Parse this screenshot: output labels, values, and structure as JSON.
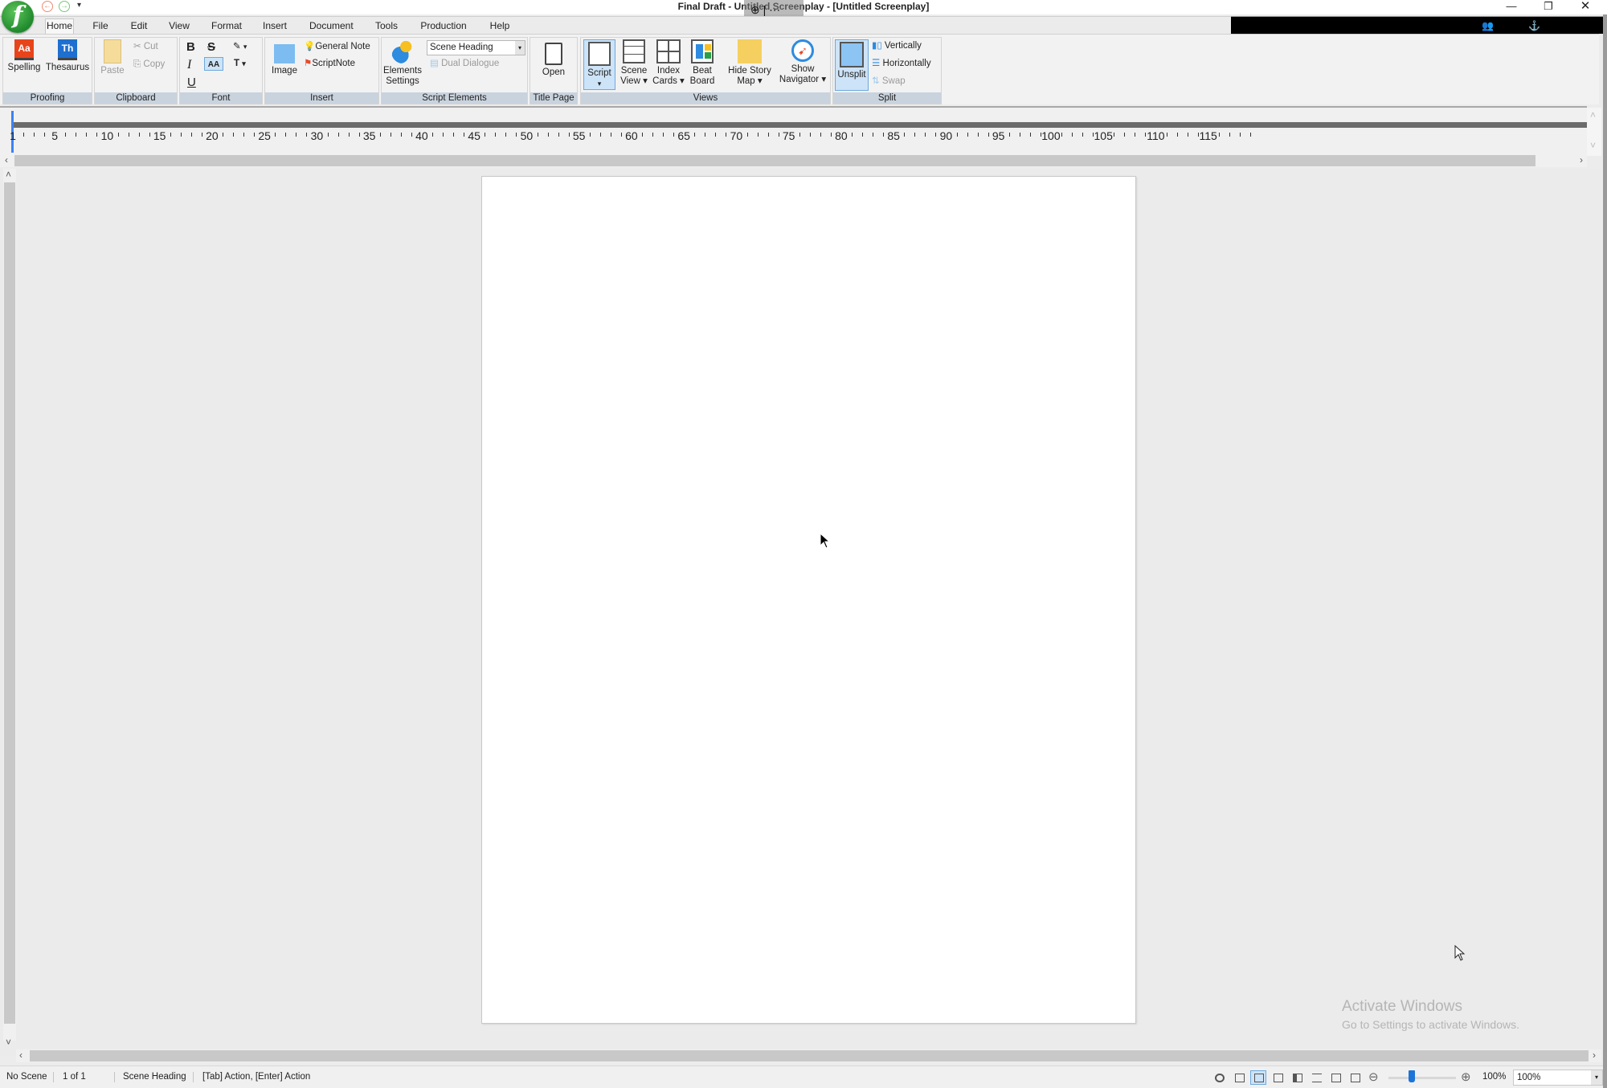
{
  "window": {
    "title": "Final Draft - Untitled Screenplay - [Untitled Screenplay]",
    "logo_letter": "f",
    "quick_access": {
      "back": "←",
      "forward": "→",
      "more": "▾"
    },
    "zoom_overlay": {
      "icon": "⊕",
      "sep": "|",
      "more": "⋯"
    },
    "controls": {
      "minimize": "—",
      "restore": "❐",
      "close": "✕"
    }
  },
  "menu": {
    "tabs": [
      "Home",
      "File",
      "Edit",
      "View",
      "Format",
      "Insert",
      "Document",
      "Tools",
      "Production",
      "Help"
    ],
    "active": "Home"
  },
  "collab": {
    "icon1": "👥",
    "icon2": "⚓"
  },
  "ribbon": {
    "proofing": {
      "label": "Proofing",
      "spelling": "Spelling",
      "thesaurus": "Thesaurus",
      "spelling_icon": "Aa",
      "thesaurus_icon": "Th"
    },
    "clipboard": {
      "label": "Clipboard",
      "paste": "Paste",
      "cut": "Cut",
      "copy": "Copy"
    },
    "font": {
      "label": "Font",
      "bold": "B",
      "strike": "S",
      "italic": "I",
      "caps": "AA",
      "underline": "U",
      "highlight": "✎",
      "text_color": "T",
      "dd": "▾"
    },
    "insert": {
      "label": "Insert",
      "image": "Image",
      "general_note": "General Note",
      "scriptnote": "ScriptNote"
    },
    "script_elements": {
      "label": "Script Elements",
      "elements_settings_1": "Elements",
      "elements_settings_2": "Settings",
      "element_select": "Scene Heading",
      "dual_dialogue": "Dual Dialogue"
    },
    "title_page": {
      "label": "Title Page",
      "open": "Open"
    },
    "views": {
      "label": "Views",
      "script_1": "Script",
      "script_2": "▾",
      "scene_view_1": "Scene",
      "scene_view_2": "View ▾",
      "index_cards_1": "Index",
      "index_cards_2": "Cards ▾",
      "beat_board_1": "Beat",
      "beat_board_2": "Board",
      "story_map_1": "Hide Story",
      "story_map_2": "Map ▾",
      "navigator_1": "Show",
      "navigator_2": "Navigator ▾"
    },
    "split": {
      "label": "Split",
      "unsplit": "Unsplit",
      "vertically": "Vertically",
      "horizontally": "Horizontally",
      "swap": "Swap"
    }
  },
  "ruler": {
    "labels": [
      "1",
      "5",
      "10",
      "15",
      "20",
      "25",
      "30",
      "35",
      "40",
      "45",
      "50",
      "55",
      "60",
      "65",
      "70",
      "75",
      "80",
      "85",
      "90",
      "95",
      "100",
      "105",
      "110",
      "115"
    ]
  },
  "scroll": {
    "left": "‹",
    "right": "›",
    "up": "˄",
    "down": "˅"
  },
  "watermark": {
    "line1": "Activate Windows",
    "line2": "Go to Settings to activate Windows."
  },
  "status": {
    "scene": "No Scene",
    "page": "1 of 1",
    "element": "Scene Heading",
    "hint": "[Tab]  Action,  [Enter] Action",
    "zoom_out": "⊖",
    "zoom_in": "⊕",
    "zoom_level": "100%",
    "zoom_percent": 0.35,
    "zoom_combo": "100%",
    "dd": "▾"
  }
}
